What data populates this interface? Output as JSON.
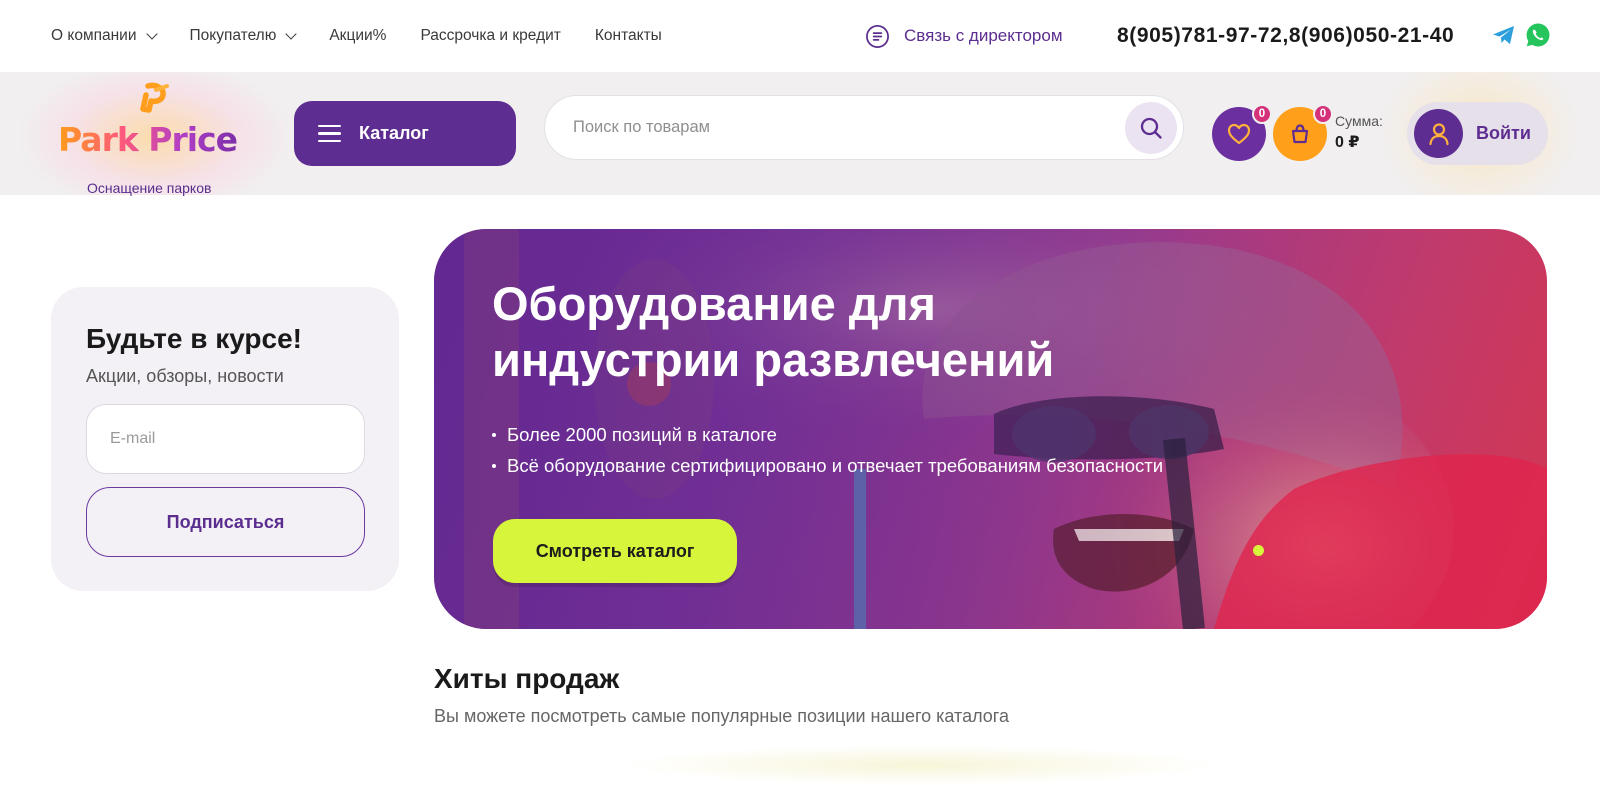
{
  "topnav": {
    "items": [
      {
        "label": "О компании",
        "dropdown": true
      },
      {
        "label": "Покупателю",
        "dropdown": true
      },
      {
        "label": "Акции%",
        "dropdown": false
      },
      {
        "label": "Рассрочка и кредит",
        "dropdown": false
      },
      {
        "label": "Контакты",
        "dropdown": false
      }
    ],
    "director_label": "Связь с директором",
    "director_icon": "message-list-icon",
    "phones": "8(905)781-97-72,8(906)050-21-40",
    "social": [
      "telegram-icon",
      "whatsapp-icon"
    ]
  },
  "header": {
    "logo_text": "Park Price",
    "logo_subtitle": "Оснащение парков",
    "catalog_label": "Каталог",
    "search_placeholder": "Поиск по товарам",
    "favorites_count": "0",
    "cart_count": "0",
    "sum_label": "Сумма:",
    "sum_value": "0 ₽",
    "login_label": "Войти"
  },
  "subscribe": {
    "title": "Будьте в курсе!",
    "subtitle": "Акции, обзоры, новости",
    "email_placeholder": "E-mail",
    "button_label": "Подписаться"
  },
  "hero": {
    "title": "Оборудование для индустрии развлечений",
    "bullets": [
      "Более 2000 позиций в каталоге",
      "Всё оборудование сертифицировано и отвечает требованиям безопасности"
    ],
    "cta_label": "Смотреть каталог"
  },
  "hits": {
    "title": "Хиты продаж",
    "subtitle": "Вы можете посмотреть самые популярные позиции нашего каталога"
  },
  "colors": {
    "brand_purple": "#5e2d91",
    "accent_orange": "#ff9f1a",
    "accent_lime": "#d7f53b",
    "badge_pink": "#d4317a"
  }
}
